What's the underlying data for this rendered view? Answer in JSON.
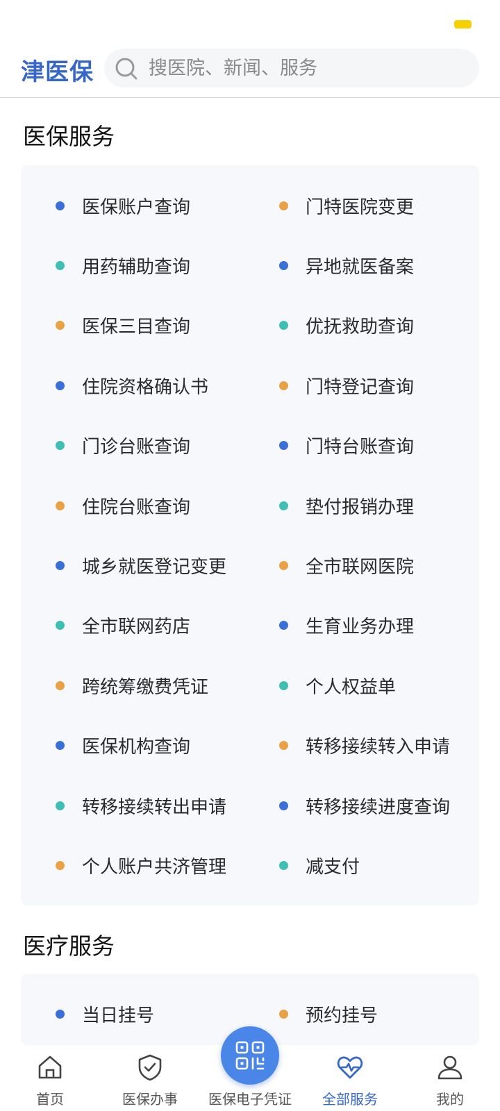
{
  "app": {
    "logo": "津医保"
  },
  "search": {
    "placeholder": "搜医院、新闻、服务"
  },
  "sections": {
    "insurance": {
      "title": "医保服务",
      "items": [
        {
          "label": "医保账户查询",
          "color": "#3a6fd8"
        },
        {
          "label": "门特医院变更",
          "color": "#e8a245"
        },
        {
          "label": "用药辅助查询",
          "color": "#3fbfb4"
        },
        {
          "label": "异地就医备案",
          "color": "#3a6fd8"
        },
        {
          "label": "医保三目查询",
          "color": "#e8a245"
        },
        {
          "label": "优抚救助查询",
          "color": "#3fbfb4"
        },
        {
          "label": "住院资格确认书",
          "color": "#3a6fd8"
        },
        {
          "label": "门特登记查询",
          "color": "#e8a245"
        },
        {
          "label": "门诊台账查询",
          "color": "#3fbfb4"
        },
        {
          "label": "门特台账查询",
          "color": "#3a6fd8"
        },
        {
          "label": "住院台账查询",
          "color": "#e8a245"
        },
        {
          "label": "垫付报销办理",
          "color": "#3fbfb4"
        },
        {
          "label": "城乡就医登记变更",
          "color": "#3a6fd8"
        },
        {
          "label": "全市联网医院",
          "color": "#e8a245"
        },
        {
          "label": "全市联网药店",
          "color": "#3fbfb4"
        },
        {
          "label": "生育业务办理",
          "color": "#3a6fd8"
        },
        {
          "label": "跨统筹缴费凭证",
          "color": "#e8a245"
        },
        {
          "label": "个人权益单",
          "color": "#3fbfb4"
        },
        {
          "label": "医保机构查询",
          "color": "#3a6fd8"
        },
        {
          "label": "转移接续转入申请",
          "color": "#e8a245"
        },
        {
          "label": "转移接续转出申请",
          "color": "#3fbfb4"
        },
        {
          "label": "转移接续进度查询",
          "color": "#3a6fd8"
        },
        {
          "label": "个人账户共济管理",
          "color": "#e8a245"
        },
        {
          "label": "减支付",
          "color": "#3fbfb4"
        }
      ]
    },
    "medical": {
      "title": "医疗服务",
      "items": [
        {
          "label": "当日挂号",
          "color": "#3a6fd8"
        },
        {
          "label": "预约挂号",
          "color": "#e8a245"
        }
      ]
    }
  },
  "tabbar": {
    "items": [
      {
        "label": "首页",
        "icon": "home-icon"
      },
      {
        "label": "医保办事",
        "icon": "shield-check-icon"
      },
      {
        "label": "医保电子凭证",
        "icon": "qr-code-icon"
      },
      {
        "label": "全部服务",
        "icon": "heart-pulse-icon",
        "active": true
      },
      {
        "label": "我的",
        "icon": "user-icon"
      }
    ],
    "active_color": "#3566c8"
  }
}
